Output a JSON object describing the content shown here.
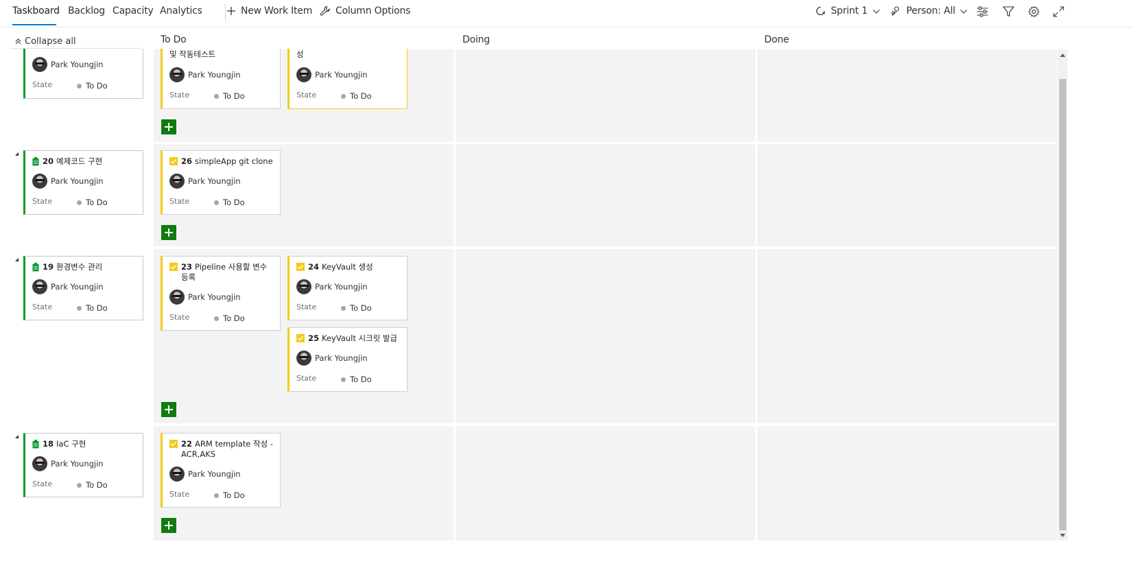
{
  "tabs": [
    "Taskboard",
    "Backlog",
    "Capacity",
    "Analytics"
  ],
  "toolbar": {
    "new_work_item": "New Work Item",
    "column_options": "Column Options",
    "sprint": "Sprint 1",
    "person": "Person: All"
  },
  "colors": {
    "accent": "#0078d4",
    "pbi": "#009b2e",
    "task": "#f2cb1d",
    "add": "#107c10"
  },
  "collapse_all": "Collapse all",
  "columns": [
    "To Do",
    "Doing",
    "Done"
  ],
  "state_label": "State",
  "rows": [
    {
      "parent": {
        "id": "",
        "title": "",
        "assignee": "Park Youngjin",
        "state": "To Do"
      },
      "tasks": [
        {
          "id": "",
          "title": "및 작동테스트",
          "assignee": "Park Youngjin",
          "state": "To Do"
        },
        {
          "id": "",
          "title": "성",
          "assignee": "Park Youngjin",
          "state": "To Do"
        }
      ]
    },
    {
      "parent": {
        "id": "20",
        "title": "예제코드 구현",
        "assignee": "Park Youngjin",
        "state": "To Do"
      },
      "tasks": [
        {
          "id": "26",
          "title": "simpleApp git clone",
          "assignee": "Park Youngjin",
          "state": "To Do"
        }
      ]
    },
    {
      "parent": {
        "id": "19",
        "title": "환경변수 관리",
        "assignee": "Park Youngjin",
        "state": "To Do"
      },
      "tasks": [
        {
          "id": "23",
          "title": "Pipeline 사용할 변수 등록",
          "assignee": "Park Youngjin",
          "state": "To Do"
        },
        {
          "id": "24",
          "title": "KeyVault 생성",
          "assignee": "Park Youngjin",
          "state": "To Do"
        },
        {
          "id": "25",
          "title": "KeyVault 시크릿 발급",
          "assignee": "Park Youngjin",
          "state": "To Do"
        }
      ]
    },
    {
      "parent": {
        "id": "18",
        "title": "IaC 구현",
        "assignee": "Park Youngjin",
        "state": "To Do"
      },
      "tasks": [
        {
          "id": "22",
          "title": "ARM template 작성 - ACR,AKS",
          "assignee": "Park Youngjin",
          "state": "To Do"
        }
      ]
    }
  ]
}
